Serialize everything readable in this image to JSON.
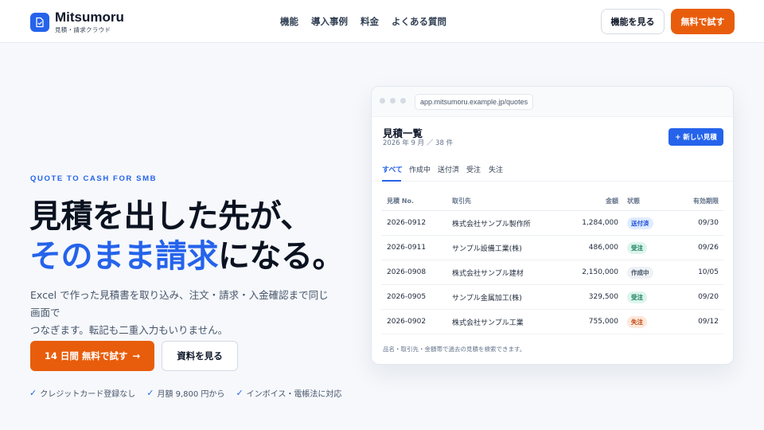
{
  "header": {
    "brand_name": "Mitsumoru",
    "brand_sub": "見積・請求クラウド",
    "nav": [
      "機能",
      "導入事例",
      "料金",
      "よくある質問"
    ],
    "btn_outline": "機能を見る",
    "btn_primary": "無料で試す"
  },
  "hero": {
    "eyebrow": "QUOTE TO CASH FOR SMB",
    "headline_line1": "見積を出した先が、",
    "headline_accent": "そのまま請求",
    "headline_rest": "になる。",
    "lead_line1": "Excel で作った見積書を取り込み、注文・請求・入金確認まで同じ画面で",
    "lead_line2": "つなぎます。転記も二重入力もいりません。",
    "cta_primary": "14 日間 無料で試す",
    "cta_arrow": "→",
    "cta_secondary": "資料を見る",
    "check_mark": "✓",
    "checks": [
      "クレジットカード登録なし",
      "月額 9,800 円から",
      "インボイス・電帳法に対応"
    ]
  },
  "mock": {
    "url": "app.mitsumoru.example.jp/quotes",
    "title": "見積一覧",
    "subtitle": "2026 年 9 月 ／ 38 件",
    "new_button": "+ 新しい見積",
    "tabs": [
      "すべて",
      "作成中",
      "送付済",
      "受注",
      "失注"
    ],
    "columns": {
      "no": "見積 No.",
      "client": "取引先",
      "amount": "金額",
      "status": "状態",
      "due": "有効期限"
    },
    "rows": [
      {
        "no": "2026-0912",
        "client": "株式会社サンプル製作所",
        "amount": "1,284,000",
        "status": "送付済",
        "due": "09/30"
      },
      {
        "no": "2026-0911",
        "client": "サンプル設備工業(株)",
        "amount": "486,000",
        "status": "受注",
        "due": "09/26"
      },
      {
        "no": "2026-0908",
        "client": "株式会社サンプル建材",
        "amount": "2,150,000",
        "status": "作成中",
        "due": "10/05"
      },
      {
        "no": "2026-0905",
        "client": "サンプル金属加工(株)",
        "amount": "329,500",
        "status": "受注",
        "due": "09/20"
      },
      {
        "no": "2026-0902",
        "client": "株式会社サンプル工業",
        "amount": "755,000",
        "status": "失注",
        "due": "09/12"
      }
    ],
    "footer": "品名・取引先・金額帯で過去の見積を検索できます。"
  },
  "colors": {
    "brand": "#2563eb",
    "cta": "#e85d0c",
    "status_sent_bg": "#e0ecff",
    "status_sent_fg": "#1d4ed8",
    "status_won_bg": "#dcf5ec",
    "status_won_fg": "#0f7a55",
    "status_draft_bg": "#eef1f5",
    "status_draft_fg": "#475569",
    "status_lost_bg": "#fde8dc",
    "status_lost_fg": "#c2410c"
  }
}
